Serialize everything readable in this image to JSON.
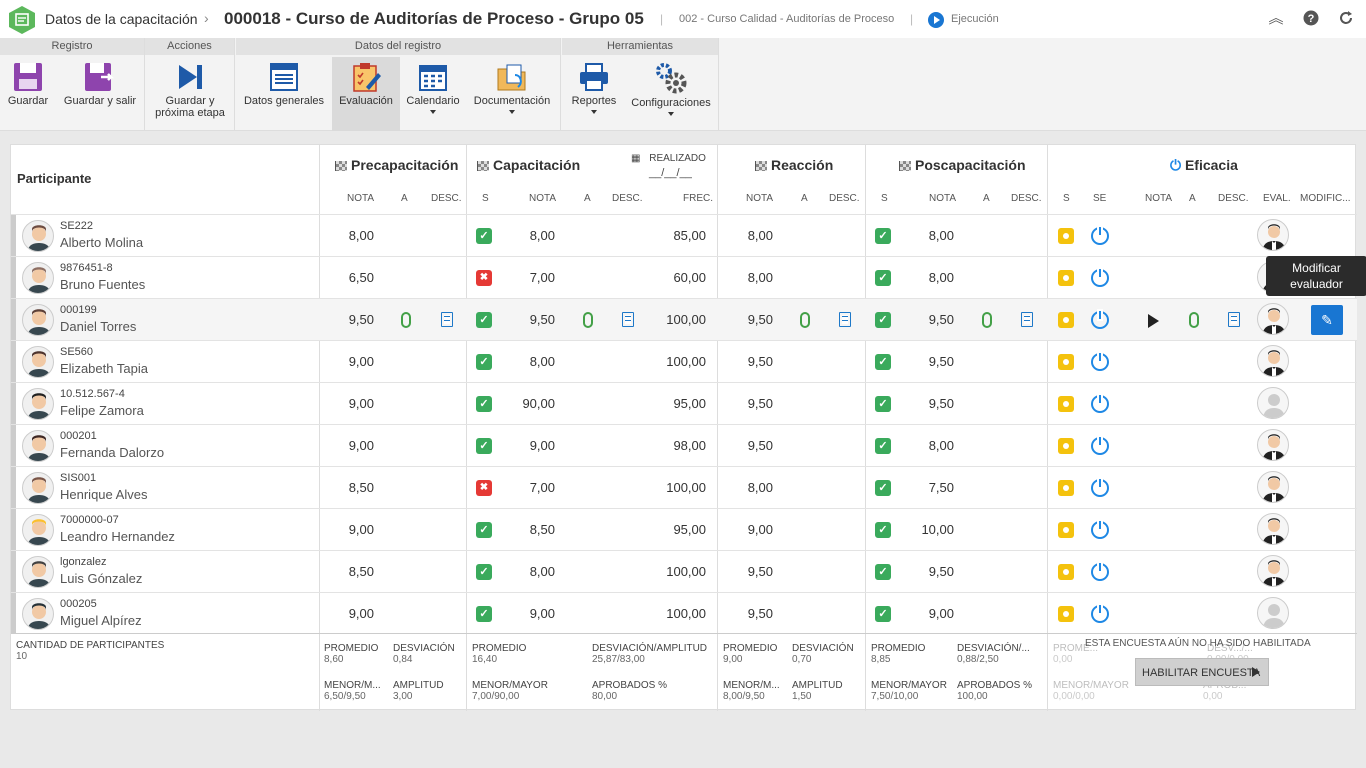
{
  "header": {
    "module": "Datos de la capacitación",
    "title": "000018 - Curso de Auditorías de Proceso - Grupo 05",
    "course": "002 - Curso Calidad - Auditorías de Proceso",
    "status": "Ejecución",
    "icons": [
      "collapse-icon",
      "help-icon",
      "refresh-icon"
    ]
  },
  "ribbon": {
    "groups": [
      "Registro",
      "Acciones",
      "Datos del registro",
      "Herramientas"
    ],
    "buttons": {
      "save": "Guardar",
      "save_exit": "Guardar y salir",
      "save_next_1": "Guardar y",
      "save_next_2": "próxima etapa",
      "general": "Datos generales",
      "evaluation": "Evaluación",
      "calendar": "Calendario",
      "documentation": "Documentación",
      "reports": "Reportes",
      "settings": "Configuraciones"
    }
  },
  "table": {
    "participant_header": "Participante",
    "sections": {
      "pre": "Precapacitación",
      "cap": "Capacitación",
      "realizado": "REALIZADO",
      "realizado_date": "__/__/__",
      "reac": "Reacción",
      "pos": "Poscapacitación",
      "efi": "Eficacia"
    },
    "cols": {
      "nota": "NOTA",
      "a": "A",
      "desc": "DESC.",
      "s": "S",
      "frec": "FREC.",
      "se": "SE",
      "eval": "EVAL.",
      "modif": "MODIFIC..."
    },
    "rows": [
      {
        "id": "SE222",
        "name": "Alberto Molina",
        "pre": "8,00",
        "cap_ok": true,
        "cap": "8,00",
        "frec": "85,00",
        "reac": "8,00",
        "pos": "8,00"
      },
      {
        "id": "9876451-8",
        "name": "Bruno Fuentes",
        "pre": "6,50",
        "cap_ok": false,
        "cap": "7,00",
        "frec": "60,00",
        "reac": "8,00",
        "pos": "8,00"
      },
      {
        "id": "000199",
        "name": "Daniel Torres",
        "pre": "9,50",
        "cap_ok": true,
        "cap": "9,50",
        "frec": "100,00",
        "reac": "9,50",
        "pos": "9,50"
      },
      {
        "id": "SE560",
        "name": "Elizabeth Tapia",
        "pre": "9,00",
        "cap_ok": true,
        "cap": "8,00",
        "frec": "100,00",
        "reac": "9,50",
        "pos": "9,50"
      },
      {
        "id": "10.512.567-4",
        "name": "Felipe Zamora",
        "pre": "9,00",
        "cap_ok": true,
        "cap": "90,00",
        "frec": "95,00",
        "reac": "9,50",
        "pos": "9,50"
      },
      {
        "id": "000201",
        "name": "Fernanda Dalorzo",
        "pre": "9,00",
        "cap_ok": true,
        "cap": "9,00",
        "frec": "98,00",
        "reac": "9,50",
        "pos": "8,00"
      },
      {
        "id": "SIS001",
        "name": "Henrique Alves",
        "pre": "8,50",
        "cap_ok": false,
        "cap": "7,00",
        "frec": "100,00",
        "reac": "8,00",
        "pos": "7,50"
      },
      {
        "id": "7000000-07",
        "name": "Leandro Hernandez",
        "pre": "9,00",
        "cap_ok": true,
        "cap": "8,50",
        "frec": "95,00",
        "reac": "9,00",
        "pos": "10,00"
      },
      {
        "id": "lgonzalez",
        "name": "Luis Gónzalez",
        "pre": "8,50",
        "cap_ok": true,
        "cap": "8,00",
        "frec": "100,00",
        "reac": "9,50",
        "pos": "9,50"
      },
      {
        "id": "000205",
        "name": "Miguel Alpírez",
        "pre": "9,00",
        "cap_ok": true,
        "cap": "9,00",
        "frec": "100,00",
        "reac": "9,50",
        "pos": "9,00"
      }
    ],
    "tooltip_1": "Modificar",
    "tooltip_2": "evaluador"
  },
  "footer": {
    "count_label": "CANTIDAD DE PARTICIPANTES",
    "count": "10",
    "pre": {
      "promedio": "8,60",
      "desviacion": "0,84",
      "menor": "6,50/9,50",
      "amplitud": "3,00"
    },
    "cap": {
      "promedio": "16,40",
      "desv_amp": "25,87/83,00",
      "menor": "7,00/90,00",
      "aprobados": "80,00"
    },
    "reac": {
      "promedio": "9,00",
      "desviacion": "0,70",
      "menor": "8,00/9,50",
      "amplitud": "1,50"
    },
    "pos": {
      "promedio": "8,85",
      "desv_amp": "0,88/2,50",
      "menor": "7,50/10,00",
      "aprobados": "100,00"
    },
    "efi": {
      "promedio": "0,00",
      "menor": "0,00/0,00",
      "notyet": "ESTA ENCUESTA AÚN NO HA SIDO HABILITADA",
      "button": "HABILITAR ENCUESTA",
      "desv_amp": "0,00/0,00",
      "aprobados": "0,00"
    },
    "labels": {
      "promedio": "PROMEDIO",
      "desviacion": "DESVIACIÓN",
      "desv_amp": "DESVIACIÓN/AMPLITUD",
      "desv_amp_short": "DESVIACIÓN/...",
      "menor_m": "MENOR/M...",
      "menor_mayor": "MENOR/MAYOR",
      "amplitud": "AMPLITUD",
      "aprobados": "APROBADOS %",
      "promedio_short": "PROME...",
      "aprob_short": "APROB...",
      "desv_short": "DESV.../..."
    }
  }
}
